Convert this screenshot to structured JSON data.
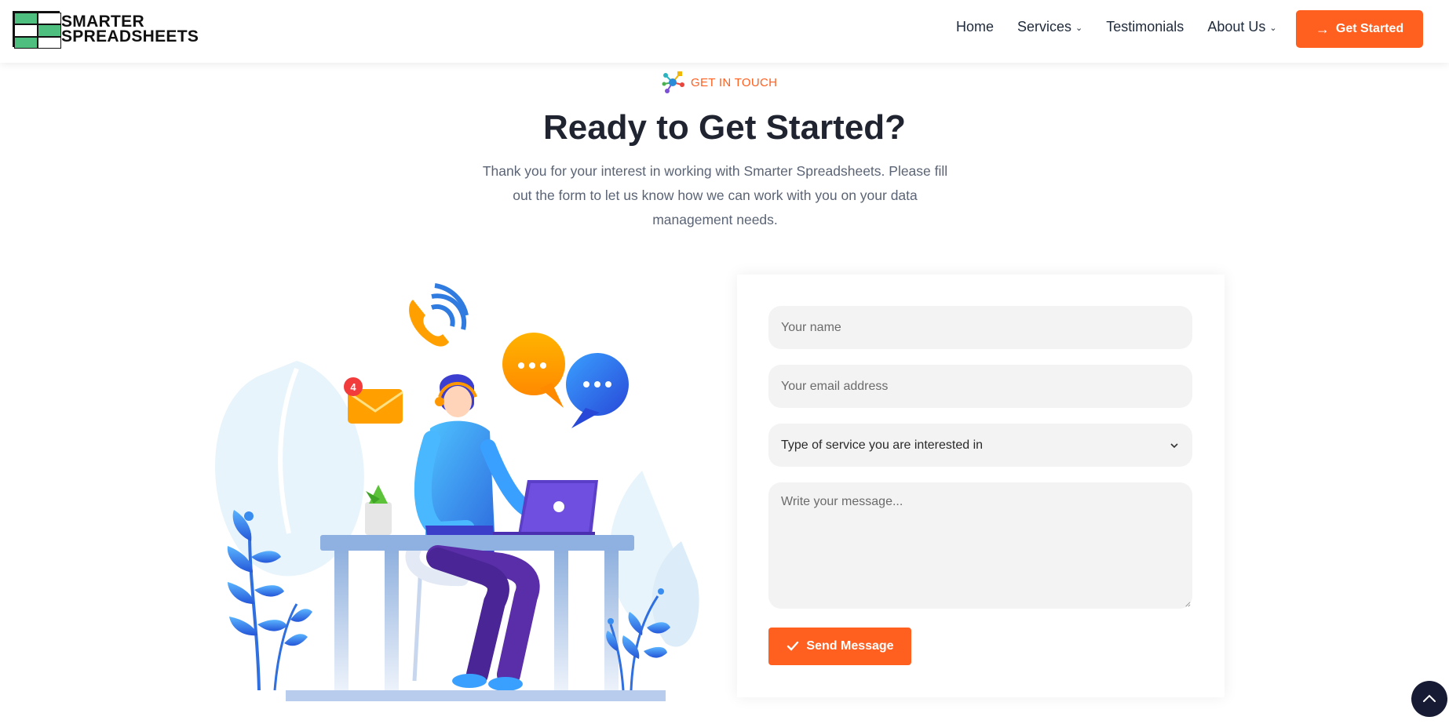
{
  "brand": {
    "line1": "SMARTER",
    "line2": "SPREADSHEETS"
  },
  "nav": {
    "items": [
      {
        "label": "Home",
        "has_dropdown": false
      },
      {
        "label": "Services",
        "has_dropdown": true
      },
      {
        "label": "Testimonials",
        "has_dropdown": false
      },
      {
        "label": "About Us",
        "has_dropdown": true
      }
    ],
    "cta_label": "Get Started"
  },
  "section": {
    "eyebrow": "GET IN TOUCH",
    "title": "Ready to Get Started?",
    "intro": "Thank you for your interest in working with Smarter Spreadsheets. Please fill out the form to let us know how we can work with you on your data management needs."
  },
  "illustration": {
    "notification_count": "4"
  },
  "form": {
    "name_placeholder": "Your name",
    "email_placeholder": "Your email address",
    "service_selected": "Type of service you are interested in",
    "message_placeholder": "Write your message...",
    "submit_label": "Send Message"
  },
  "colors": {
    "accent": "#ff5f1f",
    "dark": "#1f2430",
    "scroll_button": "#171b33",
    "logo_green": "#4fbf7f"
  },
  "icons": [
    "chevron-down-icon",
    "arrow-right-icon",
    "check-icon",
    "chevron-up-icon",
    "network-icon"
  ]
}
